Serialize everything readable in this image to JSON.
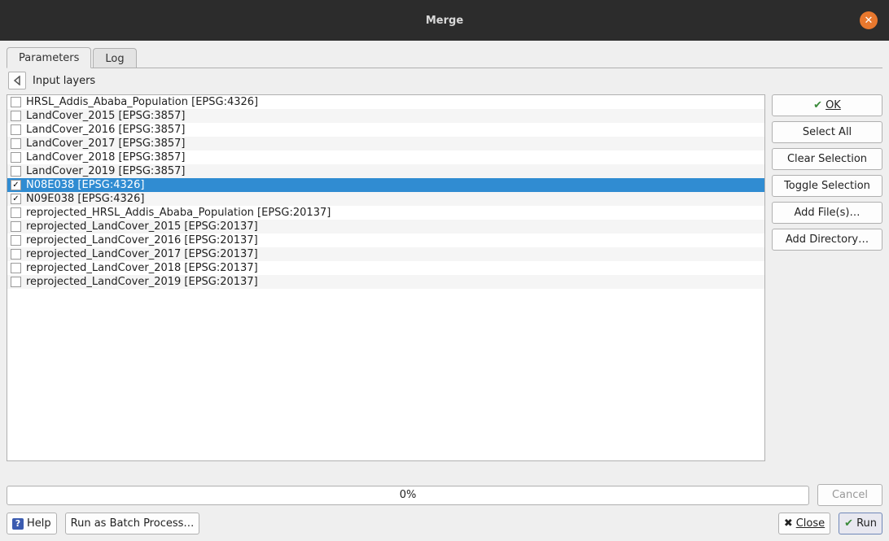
{
  "window": {
    "title": "Merge"
  },
  "tabs": {
    "parameters": "Parameters",
    "log": "Log"
  },
  "subheader": {
    "label": "Input layers"
  },
  "layers": [
    {
      "label": "HRSL_Addis_Ababa_Population [EPSG:4326]",
      "checked": false,
      "selected": false
    },
    {
      "label": "LandCover_2015 [EPSG:3857]",
      "checked": false,
      "selected": false
    },
    {
      "label": "LandCover_2016 [EPSG:3857]",
      "checked": false,
      "selected": false
    },
    {
      "label": "LandCover_2017 [EPSG:3857]",
      "checked": false,
      "selected": false
    },
    {
      "label": "LandCover_2018 [EPSG:3857]",
      "checked": false,
      "selected": false
    },
    {
      "label": "LandCover_2019 [EPSG:3857]",
      "checked": false,
      "selected": false
    },
    {
      "label": "N08E038 [EPSG:4326]",
      "checked": true,
      "selected": true
    },
    {
      "label": "N09E038 [EPSG:4326]",
      "checked": true,
      "selected": false
    },
    {
      "label": "reprojected_HRSL_Addis_Ababa_Population [EPSG:20137]",
      "checked": false,
      "selected": false
    },
    {
      "label": "reprojected_LandCover_2015 [EPSG:20137]",
      "checked": false,
      "selected": false
    },
    {
      "label": "reprojected_LandCover_2016 [EPSG:20137]",
      "checked": false,
      "selected": false
    },
    {
      "label": "reprojected_LandCover_2017 [EPSG:20137]",
      "checked": false,
      "selected": false
    },
    {
      "label": "reprojected_LandCover_2018 [EPSG:20137]",
      "checked": false,
      "selected": false
    },
    {
      "label": "reprojected_LandCover_2019 [EPSG:20137]",
      "checked": false,
      "selected": false
    }
  ],
  "side_buttons": {
    "ok": "OK",
    "select_all": "Select All",
    "clear_selection": "Clear Selection",
    "toggle_selection": "Toggle Selection",
    "add_files": "Add File(s)…",
    "add_directory": "Add Directory…"
  },
  "progress": {
    "text": "0%",
    "cancel": "Cancel"
  },
  "bottom": {
    "help": "Help",
    "batch": "Run as Batch Process…",
    "close": "Close",
    "run": "Run"
  }
}
